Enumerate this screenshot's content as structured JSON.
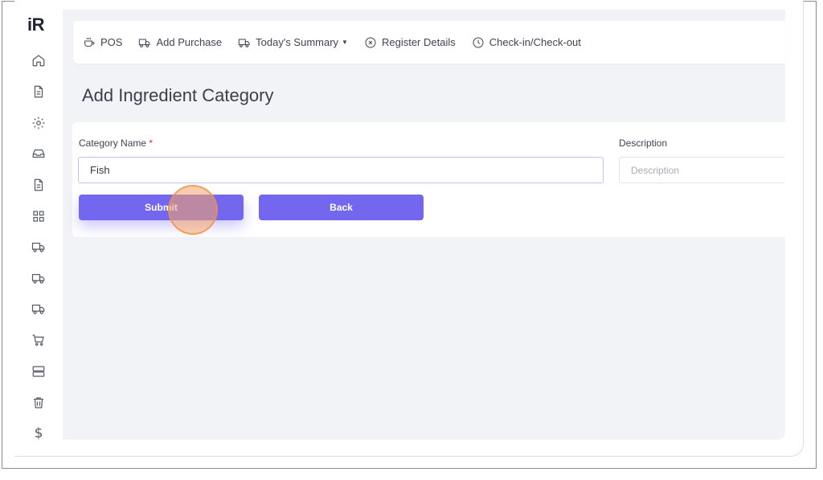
{
  "app": {
    "logo": "iR"
  },
  "sidebar": {
    "icons": [
      "home-icon",
      "document-icon",
      "gear-icon",
      "inbox-icon",
      "document-icon",
      "grid-icon",
      "truck-icon",
      "truck-icon",
      "truck-icon",
      "cart-icon",
      "server-icon",
      "trash-icon",
      "dollar-icon"
    ],
    "dollar_glyph": "$"
  },
  "topnav": {
    "items": [
      {
        "label": "POS",
        "icon": "coffee-cup-icon"
      },
      {
        "label": "Add Purchase",
        "icon": "truck-icon"
      },
      {
        "label": "Today's Summary",
        "icon": "truck-icon",
        "dropdown": true
      },
      {
        "label": "Register Details",
        "icon": "circle-x-icon"
      },
      {
        "label": "Check-in/Check-out",
        "icon": "clock-icon"
      }
    ]
  },
  "page": {
    "title": "Add Ingredient Category"
  },
  "form": {
    "category_label": "Category Name",
    "required_mark": "*",
    "category_value": "Fish",
    "description_label": "Description",
    "description_placeholder": "Description",
    "submit_label": "Submit",
    "back_label": "Back"
  },
  "colors": {
    "accent": "#7367f0",
    "background": "#f2f3f6",
    "required": "#e0312b"
  }
}
